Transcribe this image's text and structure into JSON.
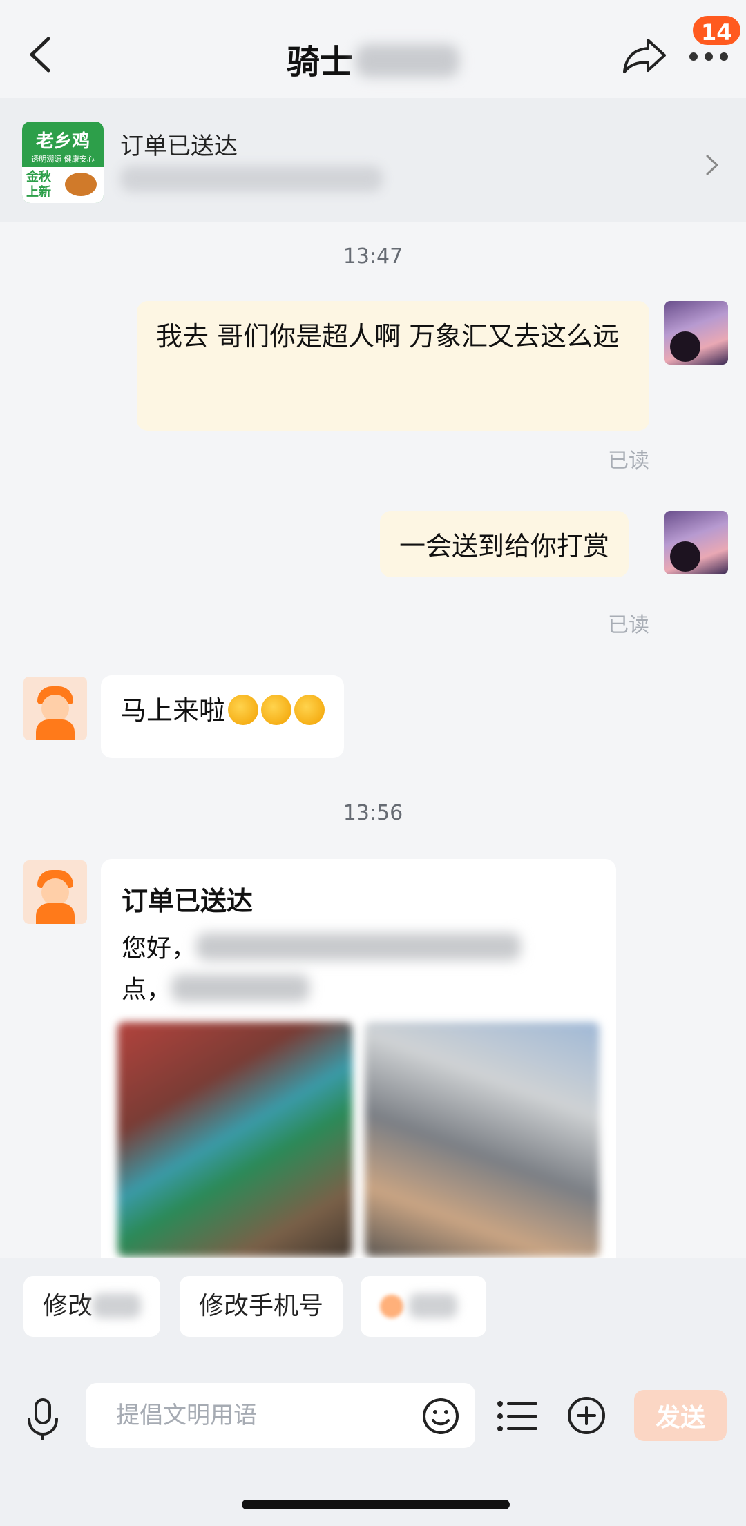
{
  "header": {
    "title": "骑士",
    "notification_count": "14"
  },
  "order_banner": {
    "store_logo_name": "老乡鸡",
    "store_logo_tagline": "透明溯源 健康安心",
    "store_logo_promo": "金秋上新",
    "status": "订单已送达"
  },
  "messages": {
    "time_1": "13:47",
    "me_1": "我去 哥们你是超人啊 万象汇又去这么远",
    "me_1_status": "已读",
    "me_2": "一会送到给你打赏",
    "me_2_status": "已读",
    "rider_1": "马上来啦",
    "time_2": "13:56",
    "card_title": "订单已送达",
    "card_greeting": "您好，",
    "card_text_2": "点，"
  },
  "quick_replies": {
    "chip_1": "修改",
    "chip_2": "修改手机号"
  },
  "composer": {
    "placeholder": "提倡文明用语",
    "send_label": "发送"
  }
}
